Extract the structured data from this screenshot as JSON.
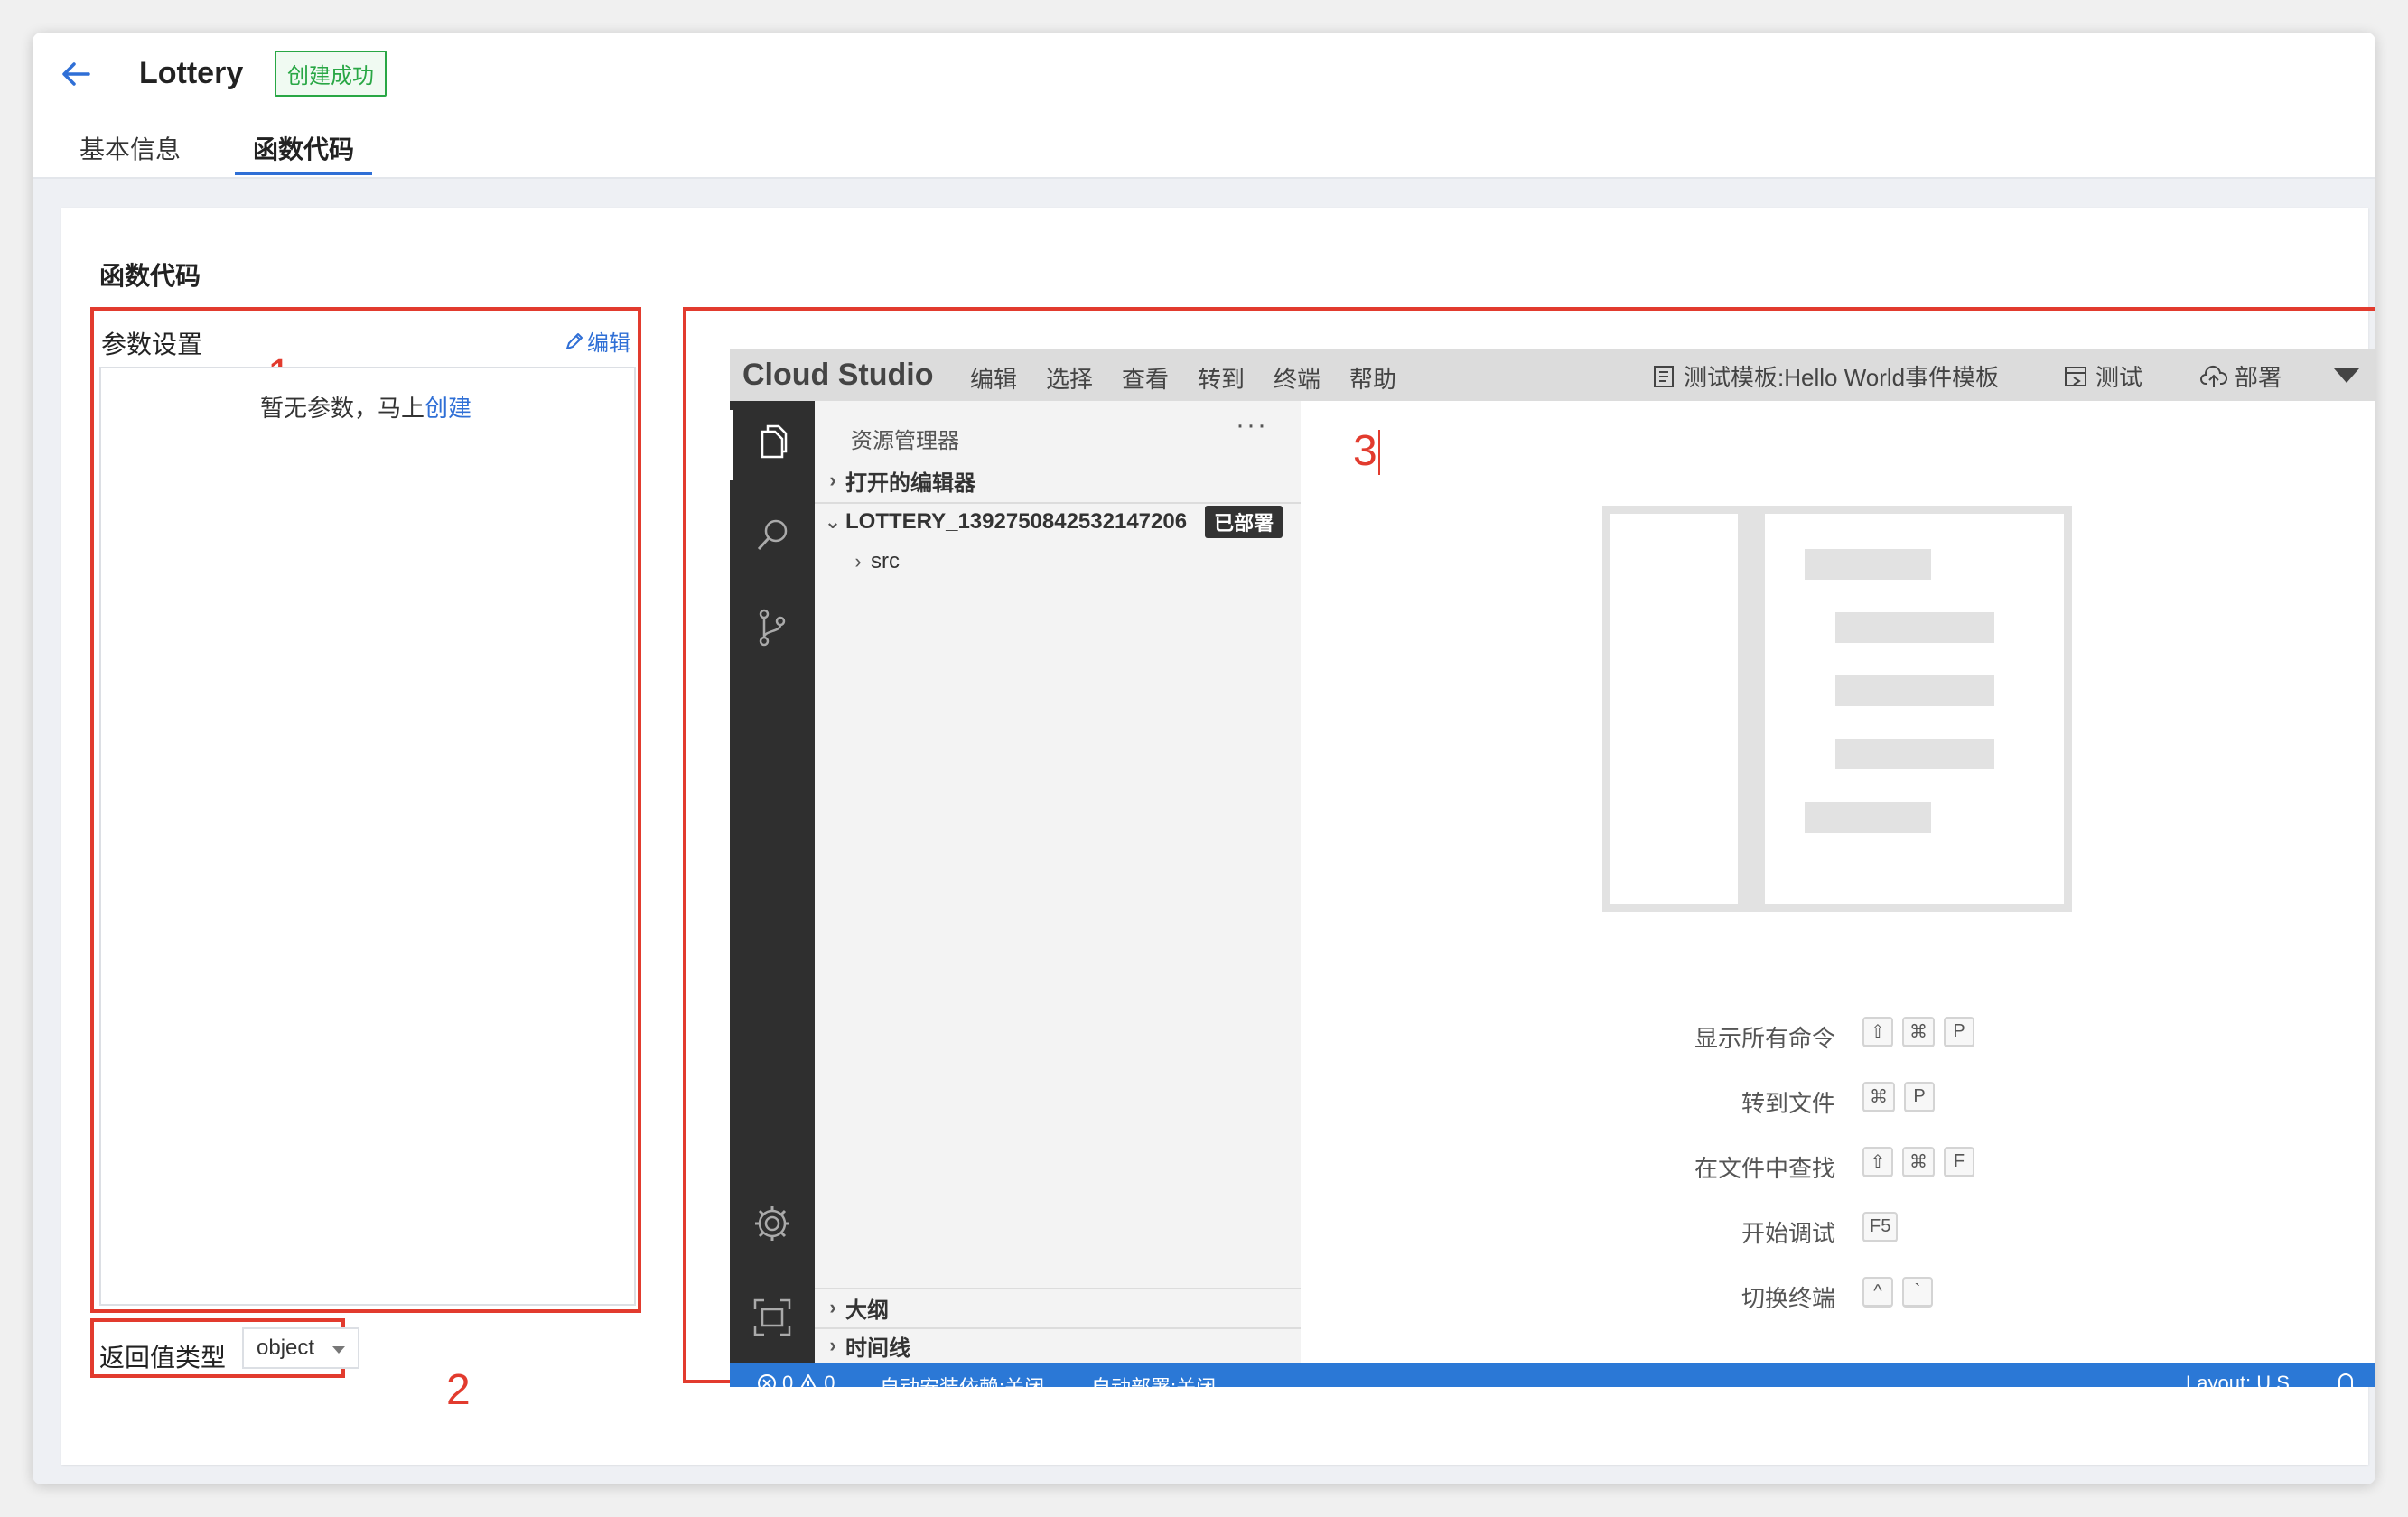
{
  "header": {
    "title": "Lottery",
    "status_badge": "创建成功",
    "tabs": [
      {
        "label": "基本信息"
      },
      {
        "label": "函数代码"
      }
    ]
  },
  "section": {
    "title": "函数代码"
  },
  "params": {
    "title": "参数设置",
    "edit_label": "编辑",
    "empty_prefix": "暂无参数，马上",
    "create_link": "创建"
  },
  "return_type": {
    "label": "返回值类型",
    "selected": "object"
  },
  "annotations": [
    "1",
    "2",
    "3"
  ],
  "ide": {
    "logo": "Cloud Studio",
    "menu": [
      "编辑",
      "选择",
      "查看",
      "转到",
      "终端",
      "帮助"
    ],
    "actions": {
      "template": "测试模板:Hello World事件模板",
      "test": "测试",
      "deploy": "部署"
    },
    "sidebar": {
      "header": "资源管理器",
      "more": "···",
      "open_editors": "打开的编辑器",
      "project": "LOTTERY_1392750842532147206",
      "project_badge": "已部署",
      "folder": "src",
      "outline": "大纲",
      "timeline": "时间线"
    },
    "shortcuts": [
      {
        "label": "显示所有命令",
        "keys": [
          "⇧",
          "⌘",
          "P"
        ]
      },
      {
        "label": "转到文件",
        "keys": [
          "⌘",
          "P"
        ]
      },
      {
        "label": "在文件中查找",
        "keys": [
          "⇧",
          "⌘",
          "F"
        ]
      },
      {
        "label": "开始调试",
        "keys": [
          "F5"
        ]
      },
      {
        "label": "切换终端",
        "keys": [
          "^",
          "`"
        ]
      }
    ],
    "statusbar": {
      "errors": "0",
      "warnings": "0",
      "auto_install": "自动安装依赖:关闭",
      "auto_deploy": "自动部署:关闭",
      "layout": "Layout: U.S."
    }
  },
  "colors": {
    "accent": "#2f6fd6",
    "success": "#29a745",
    "annotation": "#e23b2e",
    "statusbar": "#2b78d6",
    "activity_bar": "#2f2f2f"
  }
}
